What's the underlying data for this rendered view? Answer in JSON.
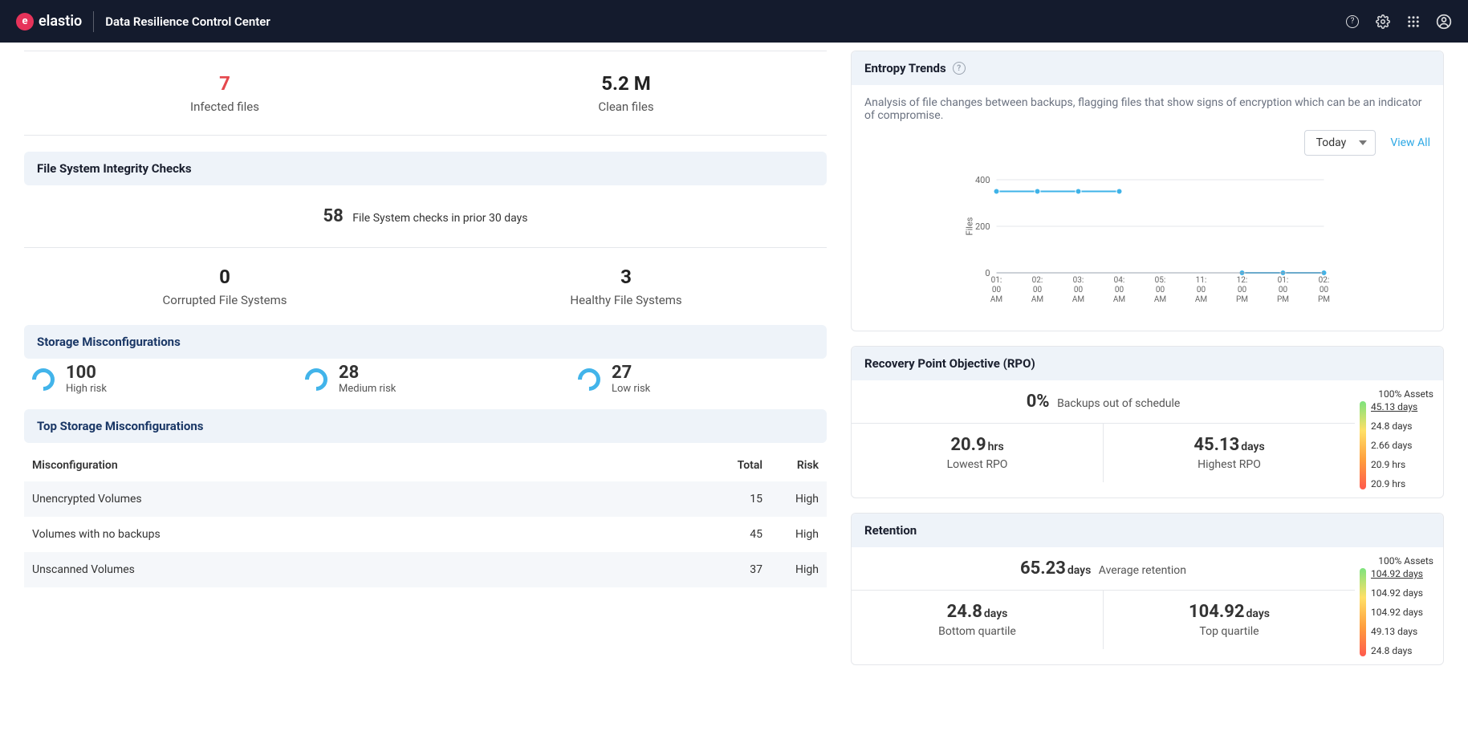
{
  "header": {
    "brand": "elastio",
    "app_title": "Data Resilience Control Center"
  },
  "files": {
    "infected": {
      "value": "7",
      "label": "Infected files"
    },
    "clean": {
      "value": "5.2 M",
      "label": "Clean files"
    }
  },
  "fs_integrity": {
    "title": "File System Integrity Checks",
    "count": "58",
    "count_label": "File System checks in prior 30 days",
    "corrupted": {
      "value": "0",
      "label": "Corrupted File Systems"
    },
    "healthy": {
      "value": "3",
      "label": "Healthy File Systems"
    }
  },
  "storage_misconfig": {
    "title": "Storage Misconfigurations",
    "high": {
      "value": "100",
      "label": "High risk"
    },
    "medium": {
      "value": "28",
      "label": "Medium risk"
    },
    "low": {
      "value": "27",
      "label": "Low risk"
    }
  },
  "top_misconfig": {
    "title": "Top Storage Misconfigurations",
    "cols": {
      "name": "Misconfiguration",
      "total": "Total",
      "risk": "Risk"
    },
    "rows": [
      {
        "name": "Unencrypted Volumes",
        "total": "15",
        "risk": "High"
      },
      {
        "name": "Volumes with no backups",
        "total": "45",
        "risk": "High"
      },
      {
        "name": "Unscanned Volumes",
        "total": "37",
        "risk": "High"
      }
    ]
  },
  "entropy": {
    "title": "Entropy Trends",
    "desc": "Analysis of file changes between backups, flagging files that show signs of encryption which can be an indicator of compromise.",
    "period": "Today",
    "view_all": "View All"
  },
  "chart_data": {
    "type": "line",
    "ylabel": "Files",
    "ylim": [
      0,
      400
    ],
    "y_ticks": [
      0,
      200,
      400
    ],
    "categories": [
      "01:00 AM",
      "02:00 AM",
      "03:00 AM",
      "04:00 AM",
      "05:00 AM",
      "11:00 AM",
      "12:00 PM",
      "01:00 PM",
      "02:00 PM"
    ],
    "values": [
      350,
      350,
      350,
      350,
      null,
      null,
      0,
      0,
      0
    ]
  },
  "rpo": {
    "title": "Recovery Point Objective (RPO)",
    "backups_out": {
      "value": "0%",
      "label": "Backups out of schedule"
    },
    "lowest": {
      "value": "20.9",
      "unit": "hrs",
      "label": "Lowest RPO"
    },
    "highest": {
      "value": "45.13",
      "unit": "days",
      "label": "Highest RPO"
    },
    "scale_top": "100% Assets",
    "scale": [
      "45.13 days",
      "24.8 days",
      "2.66 days",
      "20.9 hrs",
      "20.9 hrs"
    ]
  },
  "retention": {
    "title": "Retention",
    "avg": {
      "value": "65.23",
      "unit": "days",
      "label": "Average retention"
    },
    "bottom": {
      "value": "24.8",
      "unit": "days",
      "label": "Bottom quartile"
    },
    "top": {
      "value": "104.92",
      "unit": "days",
      "label": "Top quartile"
    },
    "scale_top": "100% Assets",
    "scale": [
      "104.92 days",
      "104.92 days",
      "104.92 days",
      "49.13 days",
      "24.8 days"
    ]
  }
}
